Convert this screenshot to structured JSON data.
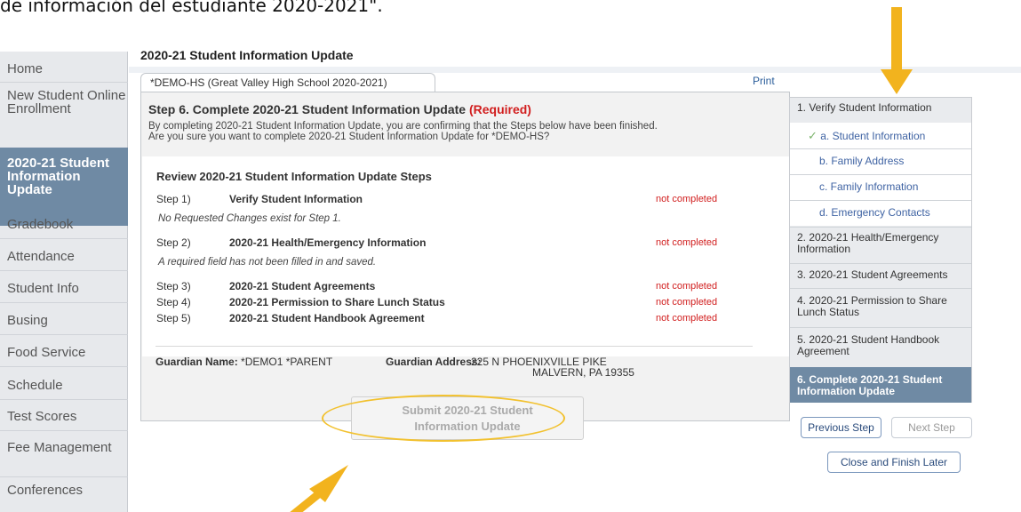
{
  "caption": "de información del estudiante 2020-2021\".",
  "sidebar": {
    "items": [
      {
        "label": "Home"
      },
      {
        "label": "New Student Online Enrollment"
      },
      {
        "label": "2020-21 Student Information Update"
      },
      {
        "label": "Gradebook"
      },
      {
        "label": "Attendance"
      },
      {
        "label": "Student Info"
      },
      {
        "label": "Busing"
      },
      {
        "label": "Food Service"
      },
      {
        "label": "Schedule"
      },
      {
        "label": "Test Scores"
      },
      {
        "label": "Fee Management"
      },
      {
        "label": "Conferences"
      }
    ]
  },
  "page_title": "2020-21 Student Information Update",
  "tab_label": "*DEMO-HS (Great Valley High School 2020-2021)",
  "print_label": "Print",
  "step_heading": "Step 6. Complete 2020-21 Student Information Update",
  "required_label": "(Required)",
  "confirm_line1": "By completing 2020-21 Student Information Update, you are confirming that the Steps below have been finished.",
  "confirm_line2": "Are you sure you want to complete 2020-21 Student Information Update for *DEMO-HS?",
  "review_title": "Review 2020-21 Student Information Update Steps",
  "steps": [
    {
      "num": "Step 1)",
      "name": "Verify Student Information",
      "status": "not completed",
      "note": "No Requested Changes exist for Step 1."
    },
    {
      "num": "Step 2)",
      "name": "2020-21 Health/Emergency Information",
      "status": "not completed",
      "note": "A required field has not been filled in and saved."
    },
    {
      "num": "Step 3)",
      "name": "2020-21 Student Agreements",
      "status": "not completed"
    },
    {
      "num": "Step 4)",
      "name": "2020-21 Permission to Share Lunch Status",
      "status": "not completed"
    },
    {
      "num": "Step 5)",
      "name": "2020-21 Student Handbook Agreement",
      "status": "not completed"
    }
  ],
  "guardian_name_label": "Guardian Name:",
  "guardian_name": "*DEMO1 *PARENT",
  "guardian_address_label": "Guardian Address:",
  "guardian_address_1": "225 N PHOENIXVILLE PIKE",
  "guardian_address_2": "MALVERN, PA 19355",
  "submit_line1": "Submit 2020-21 Student",
  "submit_line2": "Information Update",
  "right_nav": {
    "items": [
      {
        "label": "1. Verify Student Information"
      },
      {
        "label": "a. Student Information"
      },
      {
        "label": "b. Family Address"
      },
      {
        "label": "c. Family Information"
      },
      {
        "label": "d. Emergency Contacts"
      },
      {
        "label": "2. 2020-21 Health/Emergency Information"
      },
      {
        "label": "3. 2020-21 Student Agreements"
      },
      {
        "label": "4. 2020-21 Permission to Share Lunch Status"
      },
      {
        "label": "5. 2020-21 Student Handbook Agreement"
      },
      {
        "label": "6. Complete 2020-21 Student Information Update"
      }
    ]
  },
  "buttons": {
    "previous": "Previous Step",
    "next": "Next Step",
    "close": "Close and Finish Later"
  },
  "colors": {
    "accent_nav": "#6f8aa4",
    "required_red": "#d11e1e",
    "annotation_arrow": "#f2b31e"
  }
}
